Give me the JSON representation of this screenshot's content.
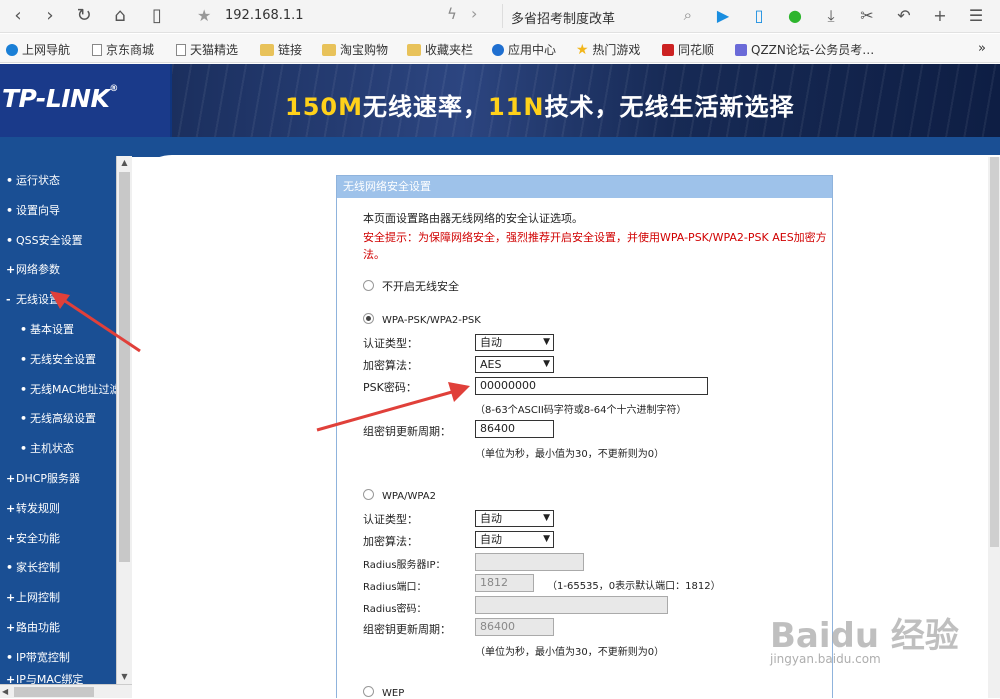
{
  "browser": {
    "url": "192.168.1.1",
    "search_text": "多省招考制度改革"
  },
  "bookmarks": [
    {
      "label": "上网导航",
      "icon": "e-icon"
    },
    {
      "label": "京东商城",
      "icon": "page-icon"
    },
    {
      "label": "天猫精选",
      "icon": "page-icon"
    },
    {
      "label": "链接",
      "icon": "folder-icon"
    },
    {
      "label": "淘宝购物",
      "icon": "folder-icon"
    },
    {
      "label": "收藏夹栏",
      "icon": "folder-icon"
    },
    {
      "label": "应用中心",
      "icon": "app-icon"
    },
    {
      "label": "热门游戏",
      "icon": "star-icon"
    },
    {
      "label": "同花顺",
      "icon": "ths-icon"
    },
    {
      "label": "QZZN论坛-公务员考…",
      "icon": "qz-icon"
    }
  ],
  "banner": {
    "logo": "TP-LINK",
    "logo_mark": "®",
    "slogan_a": "150M",
    "slogan_b": "无线速率，",
    "slogan_c": "11N",
    "slogan_d": "技术，无线生活新选择"
  },
  "nav": [
    {
      "label": "运行状态",
      "bullet": "•"
    },
    {
      "label": "设置向导",
      "bullet": "•"
    },
    {
      "label": "QSS安全设置",
      "bullet": "•"
    },
    {
      "label": "网络参数",
      "bullet": "+"
    },
    {
      "label": "无线设置",
      "bullet": "-"
    },
    {
      "label": "基本设置",
      "bullet": "•"
    },
    {
      "label": "无线安全设置",
      "bullet": "•"
    },
    {
      "label": "无线MAC地址过滤",
      "bullet": "•"
    },
    {
      "label": "无线高级设置",
      "bullet": "•"
    },
    {
      "label": "主机状态",
      "bullet": "•"
    },
    {
      "label": "DHCP服务器",
      "bullet": "+"
    },
    {
      "label": "转发规则",
      "bullet": "+"
    },
    {
      "label": "安全功能",
      "bullet": "+"
    },
    {
      "label": "家长控制",
      "bullet": "•"
    },
    {
      "label": "上网控制",
      "bullet": "+"
    },
    {
      "label": "路由功能",
      "bullet": "+"
    },
    {
      "label": "IP带宽控制",
      "bullet": "•"
    },
    {
      "label": "IP与MAC绑定",
      "bullet": "+"
    }
  ],
  "panel": {
    "title": "无线网络安全设置",
    "intro": "本页面设置路由器无线网络的安全认证选项。",
    "warning": "安全提示：为保障网络安全，强烈推荐开启安全设置，并使用WPA-PSK/WPA2-PSK AES加密方法。",
    "opt_none": "不开启无线安全",
    "opt_wpapsk": "WPA-PSK/WPA2-PSK",
    "auth_label": "认证类型：",
    "auth_value": "自动",
    "enc_label": "加密算法：",
    "enc_value": "AES",
    "psk_label": "PSK密码：",
    "psk_value": "00000000",
    "psk_hint": "（8-63个ASCII码字符或8-64个十六进制字符）",
    "gk_label": "组密钥更新周期：",
    "gk_value": "86400",
    "gk_hint": "（单位为秒，最小值为30，不更新则为0）",
    "opt_wpa": "WPA/WPA2",
    "auth2_label": "认证类型：",
    "auth2_value": "自动",
    "enc2_label": "加密算法：",
    "enc2_value": "自动",
    "radius_ip_label": "Radius服务器IP：",
    "radius_ip_value": "",
    "radius_port_label": "Radius端口：",
    "radius_port_value": "1812",
    "radius_port_hint": "（1-65535，0表示默认端口：1812）",
    "radius_pw_label": "Radius密码：",
    "radius_pw_value": "",
    "gk2_label": "组密钥更新周期：",
    "gk2_value": "86400",
    "gk2_hint": "（单位为秒，最小值为30，不更新则为0）",
    "opt_wep": "WEP"
  },
  "watermark": {
    "main": "Baidu 经验",
    "sub": "jingyan.baidu.com"
  },
  "colors": {
    "sidebar": "#1a4f94",
    "panel_header": "#9ec2ea",
    "warning": "#d00000",
    "arrow": "#e0403a"
  }
}
